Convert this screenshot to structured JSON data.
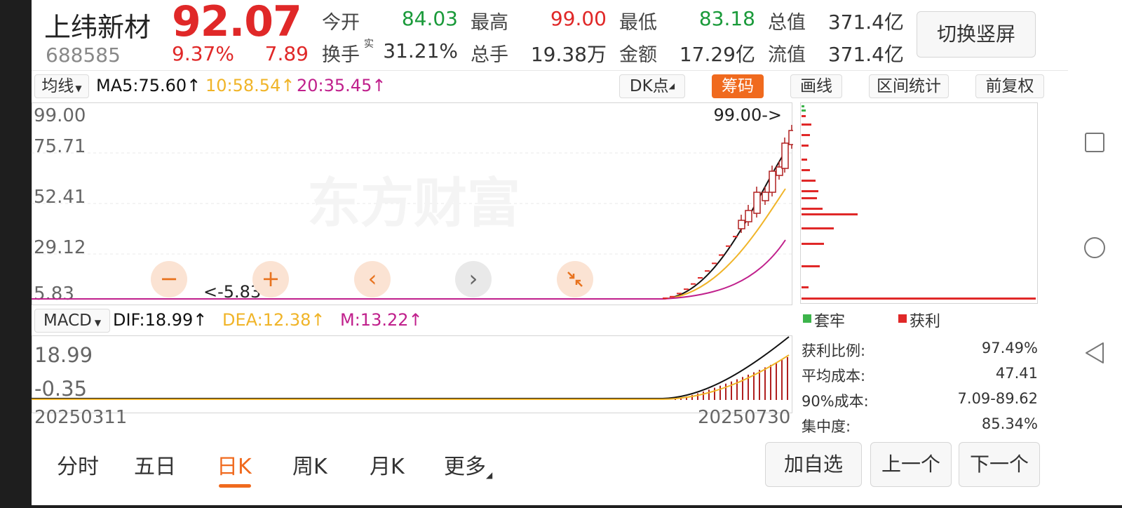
{
  "stock": {
    "name": "上纬新材",
    "code": "688585",
    "price": "92.07",
    "change_pct": "9.37%",
    "change": "7.89"
  },
  "quote": {
    "open_label": "今开",
    "open": "84.03",
    "high_label": "最高",
    "high": "99.00",
    "low_label": "最低",
    "low": "83.18",
    "total_value_label": "总值",
    "total_value": "371.4亿",
    "turnover_label": "换手",
    "turnover_sup": "实",
    "turnover": "31.21%",
    "volume_label": "总手",
    "volume": "19.38万",
    "amount_label": "金额",
    "amount": "17.29亿",
    "float_value_label": "流值",
    "float_value": "371.4亿"
  },
  "switch_button": "切换竖屏",
  "toolbar": {
    "ma_select": "均线",
    "ma5": "MA5:75.60↑",
    "ma10": "10:58.54↑",
    "ma20": "20:35.45↑",
    "dk_button": "DK点",
    "chip_button": "筹码",
    "draw_button": "画线",
    "range_button": "区间统计",
    "adjust_button": "前复权"
  },
  "colors": {
    "accent": "#f06a1e",
    "up": "#e02828",
    "down": "#1a9a3a",
    "ma5": "#111111",
    "ma10": "#f0b428",
    "ma20": "#c0208c"
  },
  "price_axis": [
    "99.00",
    "75.71",
    "52.41",
    "29.12",
    "5.83"
  ],
  "annotations": {
    "max": "99.00->",
    "min": "<-5.83"
  },
  "watermark": "东方财富",
  "chart_controls": {
    "zoom_out": "minus-icon",
    "zoom_in": "plus-icon",
    "prev": "chevron-left-icon",
    "next": "chevron-right-icon",
    "collapse": "collapse-icon"
  },
  "macd": {
    "select": "MACD",
    "dif": "DIF:18.99↑",
    "dea": "DEA:12.38↑",
    "m": "M:13.22↑",
    "axis_top": "18.99",
    "axis_bottom": "-0.35"
  },
  "dates": {
    "start": "20250311",
    "end": "20250730"
  },
  "chip": {
    "legend_trapped": "套牢",
    "legend_profit": "获利",
    "stats": [
      {
        "label": "获利比例:",
        "value": "97.49%"
      },
      {
        "label": "平均成本:",
        "value": "47.41"
      },
      {
        "label": "90%成本:",
        "value": "7.09-89.62"
      },
      {
        "label": "集中度:",
        "value": "85.34%"
      }
    ]
  },
  "tabs": [
    "分时",
    "五日",
    "日K",
    "周K",
    "月K",
    "更多"
  ],
  "active_tab": 2,
  "actions": {
    "add_watch": "加自选",
    "prev": "上一个",
    "next": "下一个"
  },
  "system_nav": [
    "square-icon",
    "circle-icon",
    "triangle-back-icon"
  ]
}
